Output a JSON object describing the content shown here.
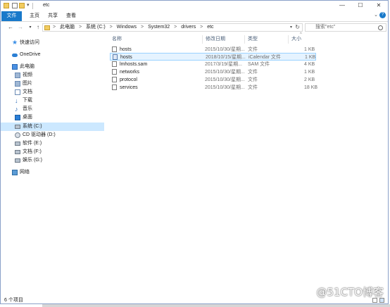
{
  "window": {
    "title": "etc"
  },
  "ribbon": {
    "tabs": [
      "文件",
      "主页",
      "共享",
      "查看"
    ],
    "controls": {
      "minimize": "—",
      "maximize": "☐",
      "close": "✕"
    },
    "expand_icon": "chevron-down-icon",
    "help_icon": "help-icon"
  },
  "nav": {
    "back": "←",
    "forward": "→",
    "recent": "▾",
    "up": "↑"
  },
  "address": {
    "crumbs": [
      "此电脑",
      "系统 (C:)",
      "Windows",
      "System32",
      "drivers",
      "etc"
    ],
    "separator": ">"
  },
  "search": {
    "placeholder": "搜索\"etc\""
  },
  "sidebar": [
    {
      "label": "快速访问",
      "icon": "star-icon"
    },
    {
      "label": "OneDrive",
      "icon": "cloud-icon"
    },
    {
      "label": "此电脑",
      "icon": "computer-icon"
    },
    {
      "label": "视频",
      "icon": "videos-folder-icon"
    },
    {
      "label": "图片",
      "icon": "pictures-folder-icon"
    },
    {
      "label": "文档",
      "icon": "documents-folder-icon"
    },
    {
      "label": "下载",
      "icon": "download-icon"
    },
    {
      "label": "音乐",
      "icon": "music-icon"
    },
    {
      "label": "桌面",
      "icon": "desktop-icon"
    },
    {
      "label": "系统 (C:)",
      "icon": "drive-icon",
      "selected": true
    },
    {
      "label": "CD 驱动器 (D:)",
      "icon": "cd-drive-icon"
    },
    {
      "label": "软件 (E:)",
      "icon": "drive-icon"
    },
    {
      "label": "文档 (F:)",
      "icon": "drive-icon"
    },
    {
      "label": "娱乐 (G:)",
      "icon": "drive-icon"
    },
    {
      "label": "网络",
      "icon": "network-icon"
    }
  ],
  "columns": {
    "name": "名称",
    "modified": "修改日期",
    "type": "类型",
    "size": "大小",
    "sort_indicator": "^"
  },
  "files": [
    {
      "name": "hosts",
      "modified": "2015/10/30/星期...",
      "type": "文件",
      "size": "1 KB"
    },
    {
      "name": "hosts",
      "modified": "2018/10/15/星期...",
      "type": "iCalendar 文件",
      "size": "1 KB",
      "selected": true
    },
    {
      "name": "lmhosts.sam",
      "modified": "2017/3/19/星期...",
      "type": "SAM 文件",
      "size": "4 KB"
    },
    {
      "name": "networks",
      "modified": "2015/10/30/星期...",
      "type": "文件",
      "size": "1 KB"
    },
    {
      "name": "protocol",
      "modified": "2015/10/30/星期...",
      "type": "文件",
      "size": "2 KB"
    },
    {
      "name": "services",
      "modified": "2015/10/30/星期...",
      "type": "文件",
      "size": "18 KB"
    }
  ],
  "status": {
    "count": "6 个项目"
  },
  "watermark": "@51CTO博客",
  "colors": {
    "accent": "#1979ca",
    "selection": "#cce8ff",
    "row_selection": "#e5f3ff"
  }
}
